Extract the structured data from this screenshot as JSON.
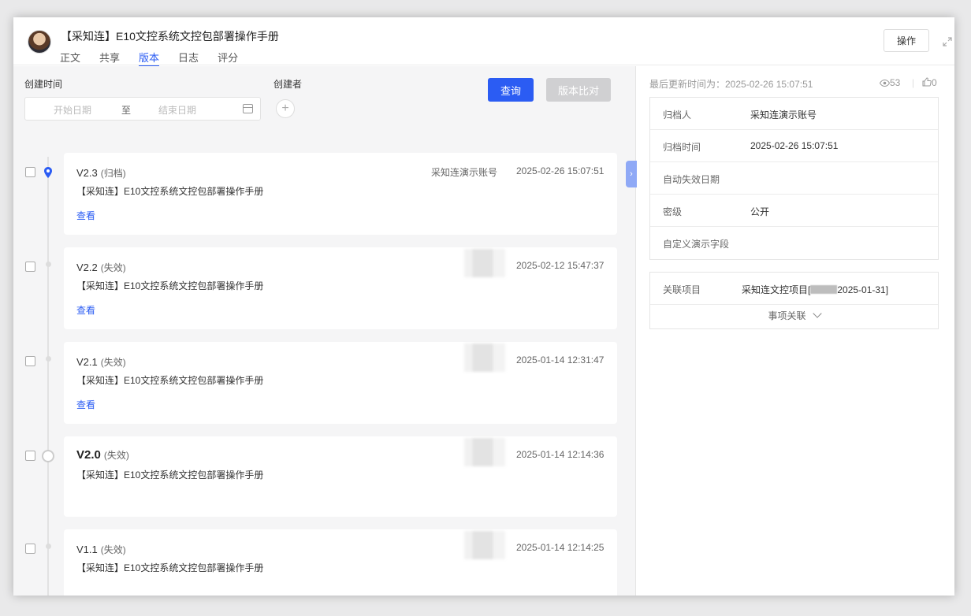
{
  "header": {
    "doc_title": "【采知连】E10文控系统文控包部署操作手册",
    "tabs": [
      {
        "label": "正文",
        "active": false
      },
      {
        "label": "共享",
        "active": false
      },
      {
        "label": "版本",
        "active": true
      },
      {
        "label": "日志",
        "active": false
      },
      {
        "label": "评分",
        "active": false
      }
    ],
    "op_button": "操作"
  },
  "filters": {
    "created_time_label": "创建时间",
    "start_placeholder": "开始日期",
    "to_label": "至",
    "end_placeholder": "结束日期",
    "creator_label": "创建者",
    "query_button": "查询",
    "compare_button": "版本比对"
  },
  "versions": [
    {
      "version": "V2.3",
      "status": "(归档)",
      "title": "【采知连】E10文控系统文控包部署操作手册",
      "creator": "采知连演示账号",
      "time": "2025-02-26 15:07:51",
      "view": "查看"
    },
    {
      "version": "V2.2",
      "status": "(失效)",
      "title": "【采知连】E10文控系统文控包部署操作手册",
      "creator": "",
      "time": "2025-02-12 15:47:37",
      "view": "查看"
    },
    {
      "version": "V2.1",
      "status": "(失效)",
      "title": "【采知连】E10文控系统文控包部署操作手册",
      "creator": "",
      "time": "2025-01-14 12:31:47",
      "view": "查看"
    },
    {
      "version": "V2.0",
      "status": "(失效)",
      "title": "【采知连】E10文控系统文控包部署操作手册",
      "creator": "",
      "time": "2025-01-14 12:14:36",
      "view": ""
    },
    {
      "version": "V1.1",
      "status": "(失效)",
      "title": "【采知连】E10文控系统文控包部署操作手册",
      "creator": "",
      "time": "2025-01-14 12:14:25",
      "view": ""
    }
  ],
  "right": {
    "updated_label": "最后更新时间为：2025-02-26 15:07:51",
    "views": "53",
    "likes": "0",
    "info": [
      {
        "key": "归档人",
        "value": "采知连演示账号"
      },
      {
        "key": "归档时间",
        "value": "2025-02-26 15:07:51"
      },
      {
        "key": "自动失效日期",
        "value": ""
      },
      {
        "key": "密级",
        "value": "公开"
      },
      {
        "key": "自定义演示字段",
        "value": ""
      }
    ],
    "related_label": "关联项目",
    "related_prefix": "采知连文控项目[",
    "related_suffix": "2025-01-31]",
    "related_more": "事项关联"
  },
  "colors": {
    "accent": "#2b5cf3",
    "disabled": "#d0d0d2"
  }
}
